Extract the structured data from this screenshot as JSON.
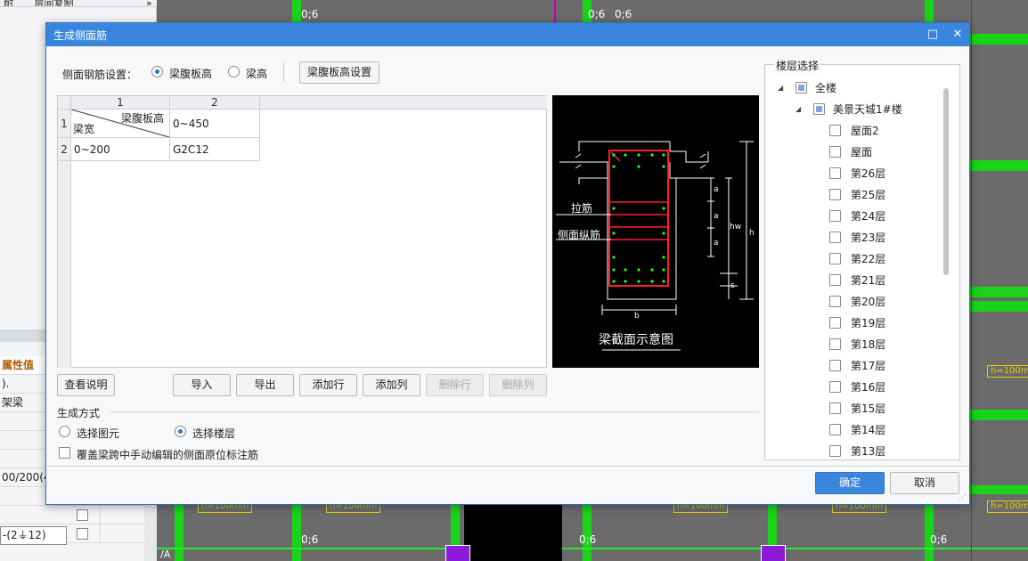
{
  "background": {
    "left_panel": {
      "tabs": [
        "耐",
        "层间复制"
      ],
      "chevron": "»",
      "property_header": "属性值",
      "rows": [
        ").",
        "架梁",
        "",
        "",
        "",
        "00/200(4",
        "",
        "-(2⏚12)",
        ""
      ],
      "field_value": "-(2⏚12)"
    },
    "canvas": {
      "labels": [
        "0;6",
        "0;6",
        "0;6",
        "0;6",
        "0;6",
        "0;6"
      ],
      "tags": [
        "h=100mm",
        "h=100mm",
        "h=100mm",
        "h=100mm",
        "h=100mm",
        "h=100mm"
      ],
      "axis_label": "/A"
    }
  },
  "dialog": {
    "title": "生成侧面筋",
    "maximize_icon": "□",
    "close_icon": "✕",
    "side_setting": {
      "label": "侧面钢筋设置：",
      "option1": "梁腹板高",
      "option2": "梁高",
      "selected": "梁腹板高",
      "setting_button": "梁腹板高设置"
    },
    "grid": {
      "col_headers": [
        "1",
        "2"
      ],
      "row_headers": [
        "1",
        "2"
      ],
      "corner_top": "梁腹板高",
      "corner_bottom": "梁宽",
      "rows": [
        [
          "",
          "0~450"
        ],
        [
          "0~200",
          "G2C12"
        ]
      ]
    },
    "diagram": {
      "tie_label": "拉筋",
      "side_bar_label": "侧面纵筋",
      "dim_a": "a",
      "dim_hw": "hw",
      "dim_h": "h",
      "dim_s": "s",
      "dim_b": "b",
      "caption": "梁截面示意图"
    },
    "buttons": {
      "help": "查看说明",
      "import": "导入",
      "export": "导出",
      "add_row": "添加行",
      "add_col": "添加列",
      "delete_row": "删除行",
      "delete_col": "删除列"
    },
    "generate": {
      "label": "生成方式",
      "option1": "选择图元",
      "option2": "选择楼层",
      "selected": "选择楼层",
      "override_label": "覆盖梁跨中手动编辑的侧面原位标注筋"
    },
    "floor_select": {
      "legend": "楼层选择",
      "root": "全楼",
      "building": "美景天城1#楼",
      "floors": [
        "屋面2",
        "屋面",
        "第26层",
        "第25层",
        "第24层",
        "第23层",
        "第22层",
        "第21层",
        "第20层",
        "第19层",
        "第18层",
        "第17层",
        "第16层",
        "第15层",
        "第14层",
        "第13层"
      ]
    },
    "ok": "确定",
    "cancel": "取消"
  }
}
